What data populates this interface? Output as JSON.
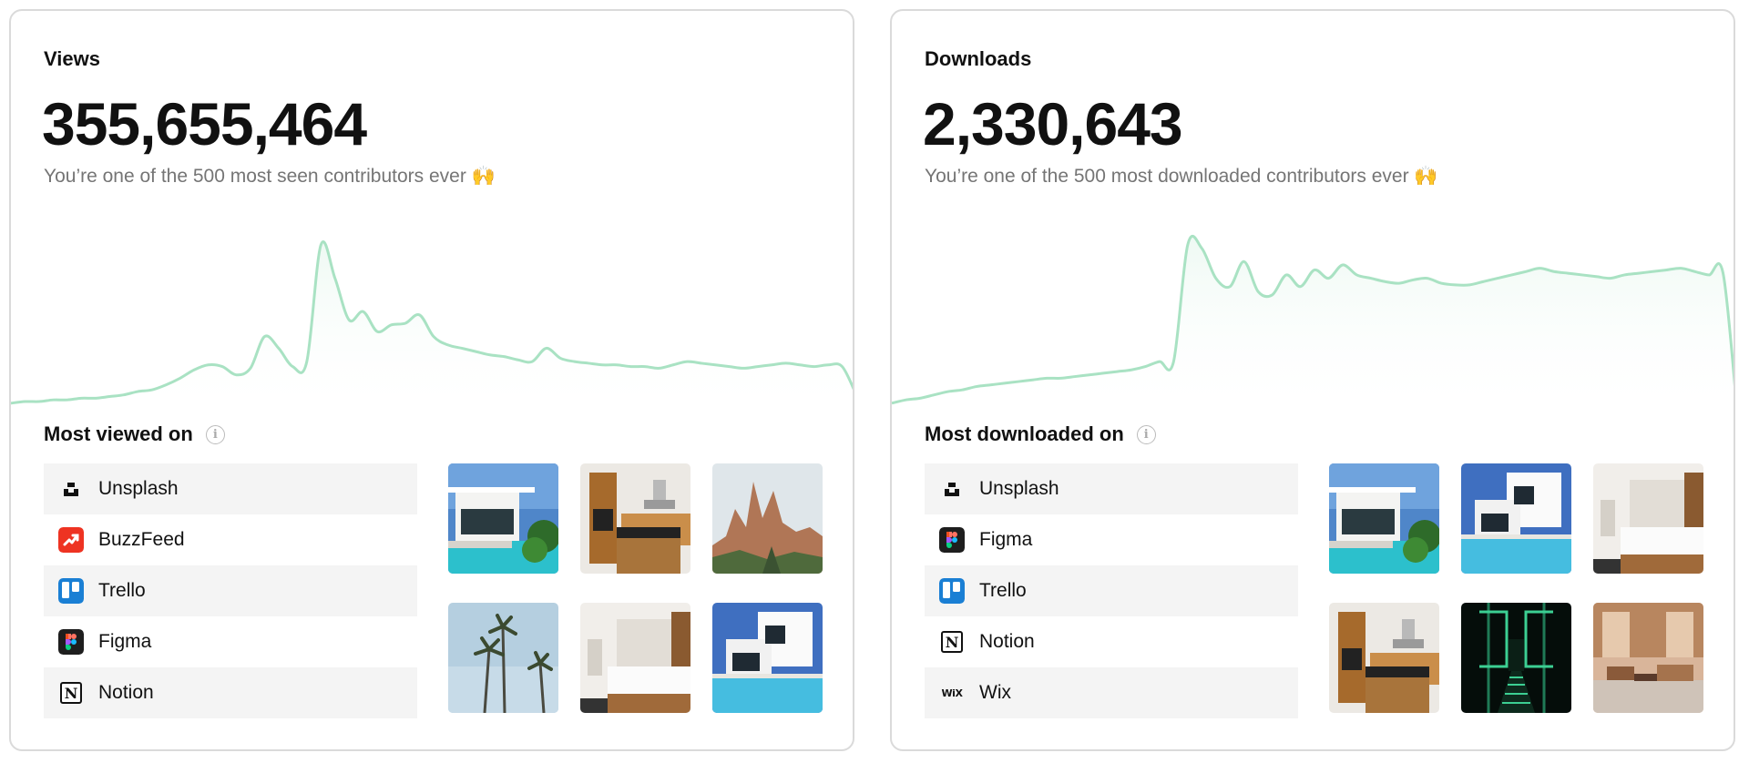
{
  "views": {
    "label": "Views",
    "value": "355,655,464",
    "message": "You’re one of the 500 most seen contributors ever 🙌",
    "section_title": "Most viewed on",
    "platforms": [
      {
        "name": "Unsplash",
        "icon": "unsplash-logo"
      },
      {
        "name": "BuzzFeed",
        "icon": "buzzfeed-logo"
      },
      {
        "name": "Trello",
        "icon": "trello-logo"
      },
      {
        "name": "Figma",
        "icon": "figma-logo"
      },
      {
        "name": "Notion",
        "icon": "notion-logo"
      }
    ],
    "photos": [
      "modern-villa-pool",
      "kitchen-interior",
      "red-rock-formations",
      "palm-trees",
      "bedroom-interior",
      "white-villa-pool"
    ]
  },
  "downloads": {
    "label": "Downloads",
    "value": "2,330,643",
    "message": "You’re one of the 500 most downloaded contributors ever 🙌",
    "section_title": "Most downloaded on",
    "platforms": [
      {
        "name": "Unsplash",
        "icon": "unsplash-logo"
      },
      {
        "name": "Figma",
        "icon": "figma-logo"
      },
      {
        "name": "Trello",
        "icon": "trello-logo"
      },
      {
        "name": "Notion",
        "icon": "notion-logo"
      },
      {
        "name": "Wix",
        "icon": "wix-logo"
      }
    ],
    "photos": [
      "modern-villa-pool",
      "white-villa-pool",
      "bedroom-interior",
      "kitchen-interior",
      "neon-green-corridor",
      "warm-lounge-interior"
    ]
  },
  "colors": {
    "line": "#a9e2c3",
    "fill": "#eef9f3",
    "border": "#dadada",
    "row_bg": "#f4f4f4",
    "muted_text": "#757575"
  },
  "chart_data": [
    {
      "type": "area",
      "y": [
        5,
        6,
        6,
        7,
        7,
        8,
        8,
        9,
        10,
        12,
        13,
        16,
        20,
        25,
        28,
        27,
        22,
        26,
        45,
        38,
        27,
        30,
        100,
        80,
        55,
        60,
        48,
        52,
        53,
        58,
        45,
        40,
        38,
        36,
        34,
        33,
        31,
        30,
        38,
        32,
        30,
        29,
        28,
        28,
        27,
        27,
        26,
        28,
        30,
        29,
        28,
        27,
        26,
        27,
        28,
        29,
        28,
        27,
        28,
        27,
        10
      ],
      "grid": false
    },
    {
      "type": "area",
      "y": [
        5,
        7,
        8,
        10,
        12,
        13,
        15,
        16,
        17,
        18,
        19,
        20,
        20,
        21,
        22,
        23,
        24,
        25,
        27,
        30,
        30,
        100,
        98,
        80,
        75,
        90,
        72,
        70,
        82,
        75,
        85,
        80,
        88,
        82,
        80,
        78,
        77,
        79,
        80,
        77,
        76,
        76,
        78,
        80,
        82,
        84,
        86,
        84,
        83,
        82,
        81,
        80,
        82,
        83,
        84,
        85,
        86,
        84,
        82,
        83,
        0
      ],
      "grid": false
    }
  ]
}
